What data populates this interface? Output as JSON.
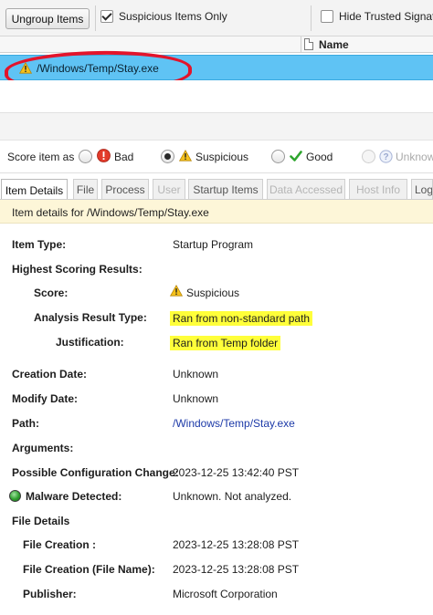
{
  "toolbar": {
    "ungroup_label": "Ungroup Items",
    "suspicious_only_label": "Suspicious Items Only",
    "suspicious_only_checked": true,
    "hide_trusted_label": "Hide Trusted Signatu",
    "hide_trusted_checked": false
  },
  "table": {
    "name_header": "Name",
    "selected_row_path": "/Windows/Temp/Stay.exe",
    "selected_row_icon": "warning-icon"
  },
  "score": {
    "label": "Score item as",
    "options": [
      {
        "label": "Bad",
        "icon": "bad-icon",
        "selected": false,
        "enabled": true
      },
      {
        "label": "Suspicious",
        "icon": "warning-icon",
        "selected": true,
        "enabled": true
      },
      {
        "label": "Good",
        "icon": "checkmark-icon",
        "selected": false,
        "enabled": true
      },
      {
        "label": "Unknow",
        "icon": "question-icon",
        "selected": false,
        "enabled": false
      }
    ]
  },
  "tabs": [
    {
      "label": "Item Details",
      "active": true,
      "enabled": true
    },
    {
      "label": "File",
      "active": false,
      "enabled": true
    },
    {
      "label": "Process",
      "active": false,
      "enabled": true
    },
    {
      "label": "User",
      "active": false,
      "enabled": false
    },
    {
      "label": "Startup Items",
      "active": false,
      "enabled": true
    },
    {
      "label": "Data Accessed",
      "active": false,
      "enabled": false
    },
    {
      "label": "Host Info",
      "active": false,
      "enabled": false
    },
    {
      "label": "Log",
      "active": false,
      "enabled": true
    }
  ],
  "details": {
    "header": "Item details for /Windows/Temp/Stay.exe",
    "item_type_label": "Item Type:",
    "item_type_value": "Startup Program",
    "highest_scoring_label": "Highest Scoring Results:",
    "score_label": "Score:",
    "score_value": "Suspicious",
    "analysis_type_label": "Analysis Result Type:",
    "analysis_type_value": "Ran from non-standard path",
    "justification_label": "Justification:",
    "justification_value": "Ran from Temp folder",
    "creation_date_label": "Creation Date:",
    "creation_date_value": "Unknown",
    "modify_date_label": "Modify Date:",
    "modify_date_value": "Unknown",
    "path_label": "Path:",
    "path_value": "/Windows/Temp/Stay.exe",
    "arguments_label": "Arguments:",
    "config_change_label": "Possible Configuration Change:",
    "config_change_value": "2023-12-25 13:42:40 PST",
    "malware_label": "Malware Detected:",
    "malware_value": "Unknown. Not analyzed.",
    "file_details_label": "File Details",
    "file_creation_label": "File Creation :",
    "file_creation_value": "2023-12-25 13:28:08 PST",
    "file_creation_fn_label": "File Creation (File Name):",
    "file_creation_fn_value": "2023-12-25 13:28:08 PST",
    "publisher_label": "Publisher:",
    "publisher_value": "Microsoft Corporation"
  },
  "colors": {
    "selection": "#5fc3f4",
    "highlight": "#ffff3a",
    "annotation_circle": "#e3142b",
    "details_header_bg": "#fdf6d8",
    "link": "#1d3aa8"
  }
}
